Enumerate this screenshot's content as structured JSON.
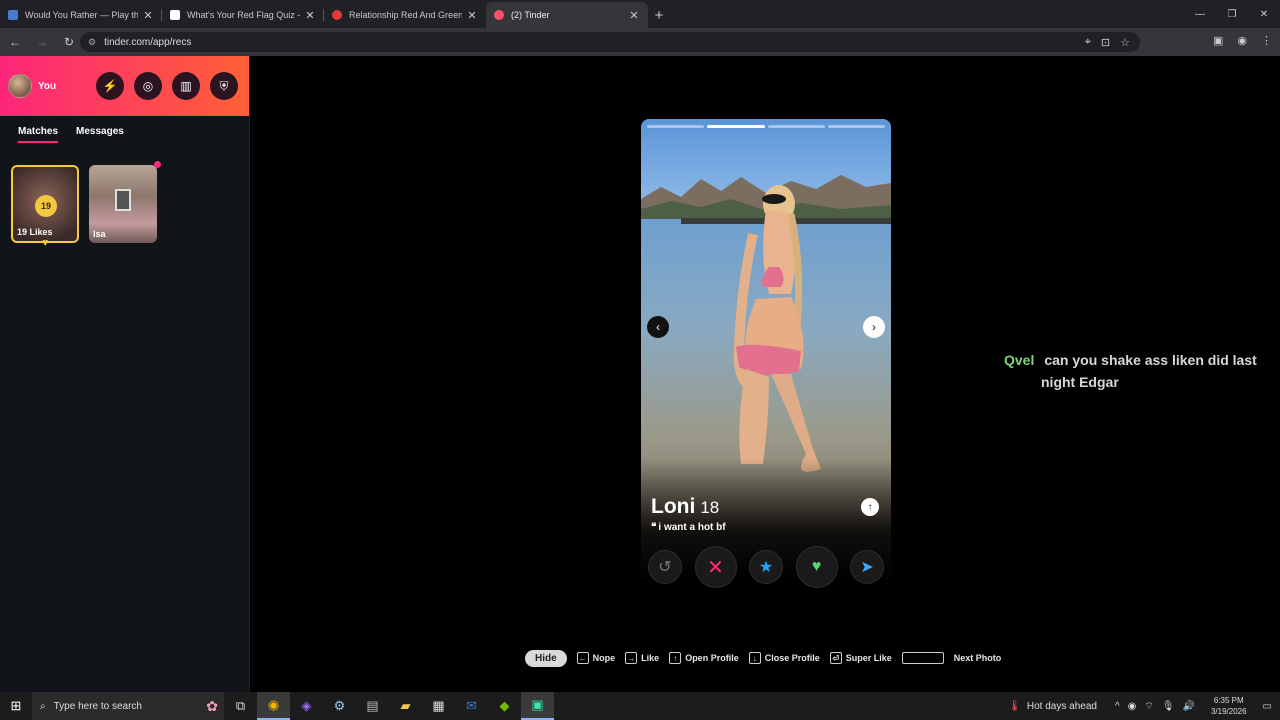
{
  "browser": {
    "tabs": [
      {
        "title": "Would You Rather — Play the G",
        "active": false,
        "favicon_color": "#4a7bd1"
      },
      {
        "title": "What's Your Red Flag Quiz - wi",
        "active": false,
        "favicon_color": "#ffffff"
      },
      {
        "title": "Relationship Red And Green Fla",
        "active": false,
        "favicon_color": "#e03a3a"
      },
      {
        "title": "(2) Tinder",
        "active": true,
        "favicon_color": "#fd5068"
      }
    ],
    "url": "tinder.com/app/recs"
  },
  "sidebar": {
    "user_label": "You",
    "tabs": [
      {
        "label": "Matches",
        "active": true
      },
      {
        "label": "Messages",
        "active": false
      }
    ],
    "likes_card": {
      "count": "19",
      "label": "19 Likes"
    },
    "match_card": {
      "name": "Isa"
    }
  },
  "profile": {
    "name": "Loni",
    "age": "18",
    "bio": "i want a hot bf",
    "photo_count": 4,
    "active_photo": 2
  },
  "actions": [
    "rewind",
    "nope",
    "super-like",
    "like",
    "boost"
  ],
  "comment": {
    "user": "Qvel",
    "text": "can you shake ass liken did last night Edgar"
  },
  "shortcuts": {
    "hide": "Hide",
    "nope": "Nope",
    "like": "Like",
    "open_profile": "Open Profile",
    "close_profile": "Close Profile",
    "super_like": "Super Like",
    "next_photo": "Next Photo"
  },
  "taskbar": {
    "search_placeholder": "Type here to search",
    "weather": "Hot days ahead",
    "time": "6:35 PM",
    "date": "3/19/2026"
  },
  "colors": {
    "brand_start": "#fd267a",
    "brand_end": "#ff6036",
    "likes_gold": "#f5c842",
    "nope": "#ff2d74",
    "like": "#55d86e",
    "super_like": "#1ea7ff",
    "comment_user": "#7bd37b"
  }
}
